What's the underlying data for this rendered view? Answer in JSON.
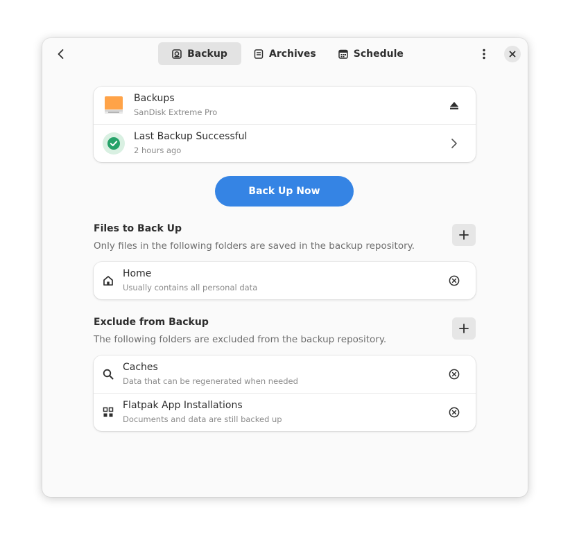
{
  "tabs": [
    {
      "label": "Backup",
      "icon": "backup-icon",
      "active": true
    },
    {
      "label": "Archives",
      "icon": "archives-icon",
      "active": false
    },
    {
      "label": "Schedule",
      "icon": "calendar-icon",
      "active": false
    }
  ],
  "status": {
    "repository": {
      "title": "Backups",
      "subtitle": "SanDisk Extreme Pro",
      "icon": "drive-icon",
      "action_icon": "eject-icon"
    },
    "last_backup": {
      "title": "Last Backup Successful",
      "subtitle": "2 hours ago",
      "icon": "success-check-icon"
    }
  },
  "backup_now_label": "Back Up Now",
  "include": {
    "title": "Files to Back Up",
    "description": "Only files in the following folders are saved in the backup repository.",
    "items": [
      {
        "title": "Home",
        "subtitle": "Usually contains all personal data",
        "icon": "home-icon"
      }
    ]
  },
  "exclude": {
    "title": "Exclude from Backup",
    "description": "The following folders are excluded from the backup repository.",
    "items": [
      {
        "title": "Caches",
        "subtitle": "Data that can be regenerated when needed",
        "icon": "search-icon"
      },
      {
        "title": "Flatpak App Installations",
        "subtitle": "Documents and data are still backed up",
        "icon": "apps-grid-icon"
      }
    ]
  },
  "colors": {
    "accent": "#3584e4",
    "success": "#26a269",
    "drive": "#ffa348"
  }
}
